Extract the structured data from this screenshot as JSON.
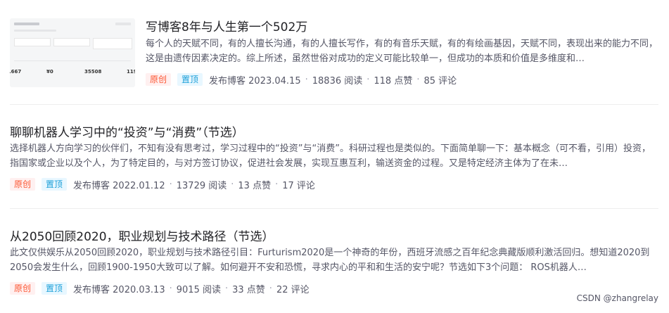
{
  "articles": [
    {
      "title": "写博客8年与人生第一个502万",
      "desc": "每个人的天赋不同，有的人擅长沟通，有的人擅长写作，有的有音乐天赋，有的有绘画基因，天赋不同，表现出来的能力不同，这是由遗传因素决定的。综上所述，虽然世俗对成功的定义可能比较单一，但成功的本质和价值是多维度和…",
      "tags": [
        "原创",
        "置顶"
      ],
      "published": "发布博客 2023.04.15",
      "reads": "18836 阅读",
      "likes": "118 点赞",
      "comments": "85 评论",
      "thumbnail": {
        "numbers": [
          ".667",
          "¥0",
          "35508",
          "119"
        ]
      }
    },
    {
      "title": "聊聊机器人学习中的“投资”与“消费”（节选）",
      "desc": "选择机器人方向学习的伙伴们，不知有没有思考过，学习过程中的“投资”与“消费”。科研过程也是类似的。下面简单聊一下：基本概念（可不看，引用）投资，指国家或企业以及个人，为了特定目的，与对方签订协议，促进社会发展，实现互惠互利，输送资金的过程。又是特定经济主体为了在未…",
      "tags": [
        "原创",
        "置顶"
      ],
      "published": "发布博客 2022.01.12",
      "reads": "13729 阅读",
      "likes": "13 点赞",
      "comments": "17 评论"
    },
    {
      "title": "从2050回顾2020，职业规划与技术路径（节选）",
      "desc": "此文仅供娱乐从2050回顾2020，职业规划与技术路径引目：Furturism2020是一个神奇的年份，西班牙流感之百年纪念典藏版顺利激活回归。想知道2020到2050会发生什么，回顾1900-1950大致可以了解。如何避开不安和恐慌，寻求内心的平和和生活的安宁呢？节选如下3个问题： ROS机器人…",
      "tags": [
        "原创",
        "置顶"
      ],
      "published": "发布博客 2020.03.13",
      "reads": "9015 阅读",
      "likes": "33 点赞",
      "comments": "22 评论"
    }
  ],
  "watermark": "CSDN @zhangrelay",
  "colors": {
    "original_tag": "#fc5531",
    "top_tag": "#1a9fd8",
    "meta_text": "#555666"
  }
}
